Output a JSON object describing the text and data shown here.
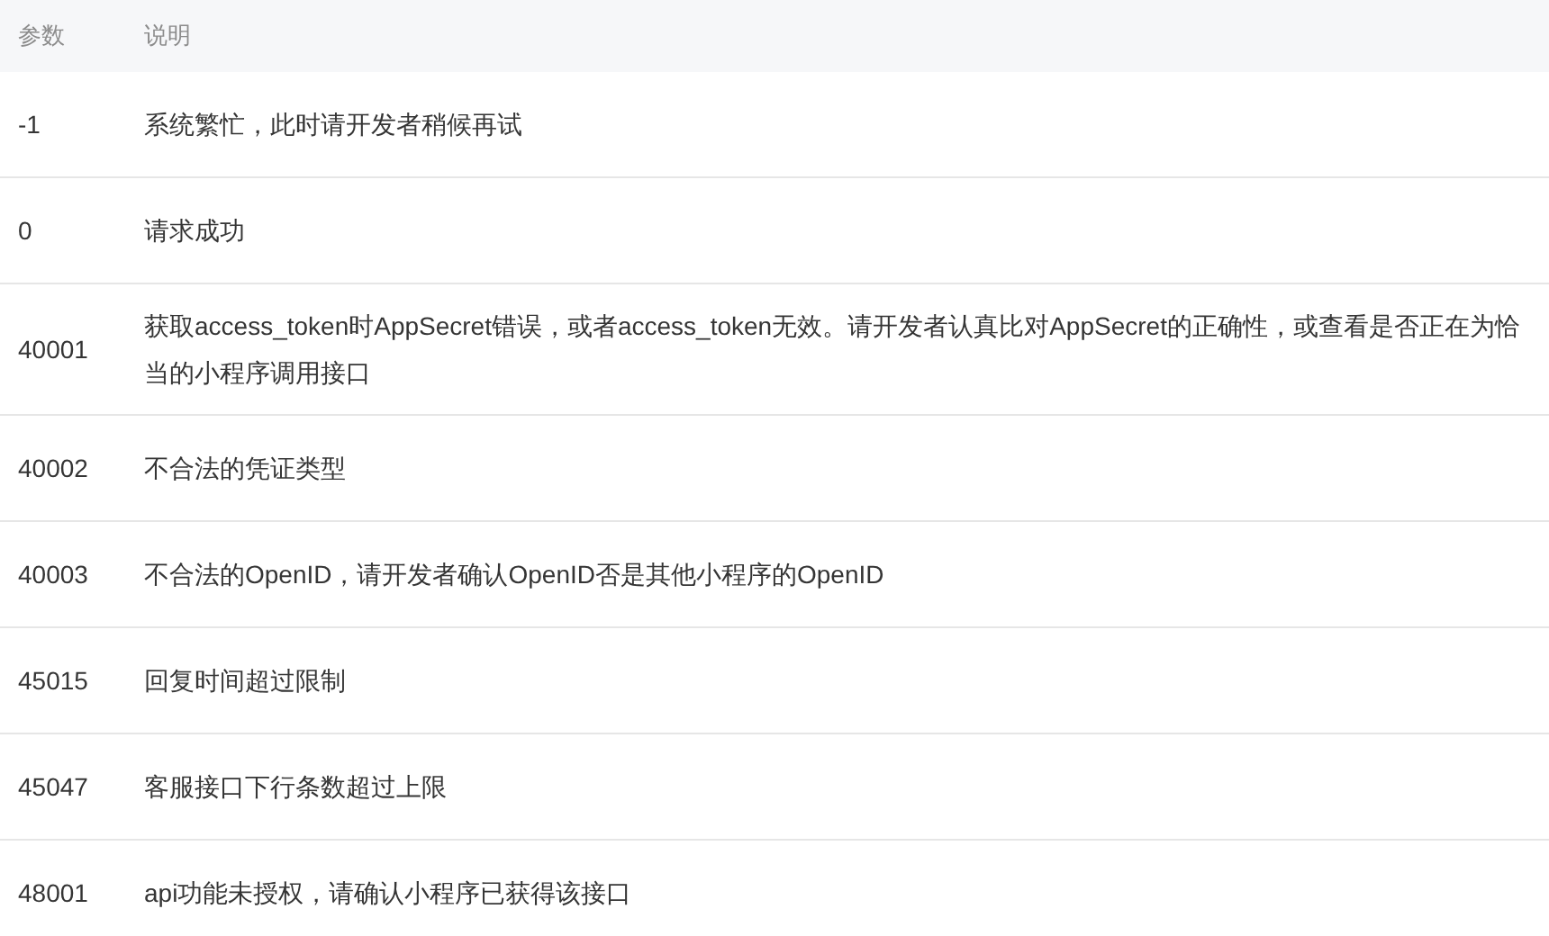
{
  "table": {
    "columns": [
      "参数",
      "说明"
    ],
    "rows": [
      {
        "code": "-1",
        "description": "系统繁忙，此时请开发者稍候再试"
      },
      {
        "code": "0",
        "description": "请求成功"
      },
      {
        "code": "40001",
        "description": "获取access_token时AppSecret错误，或者access_token无效。请开发者认真比对AppSecret的正确性，或查看是否正在为恰当的小程序调用接口"
      },
      {
        "code": "40002",
        "description": "不合法的凭证类型"
      },
      {
        "code": "40003",
        "description": "不合法的OpenID，请开发者确认OpenID否是其他小程序的OpenID"
      },
      {
        "code": "45015",
        "description": "回复时间超过限制"
      },
      {
        "code": "45047",
        "description": "客服接口下行条数超过上限"
      },
      {
        "code": "48001",
        "description": "api功能未授权，请确认小程序已获得该接口"
      }
    ]
  }
}
